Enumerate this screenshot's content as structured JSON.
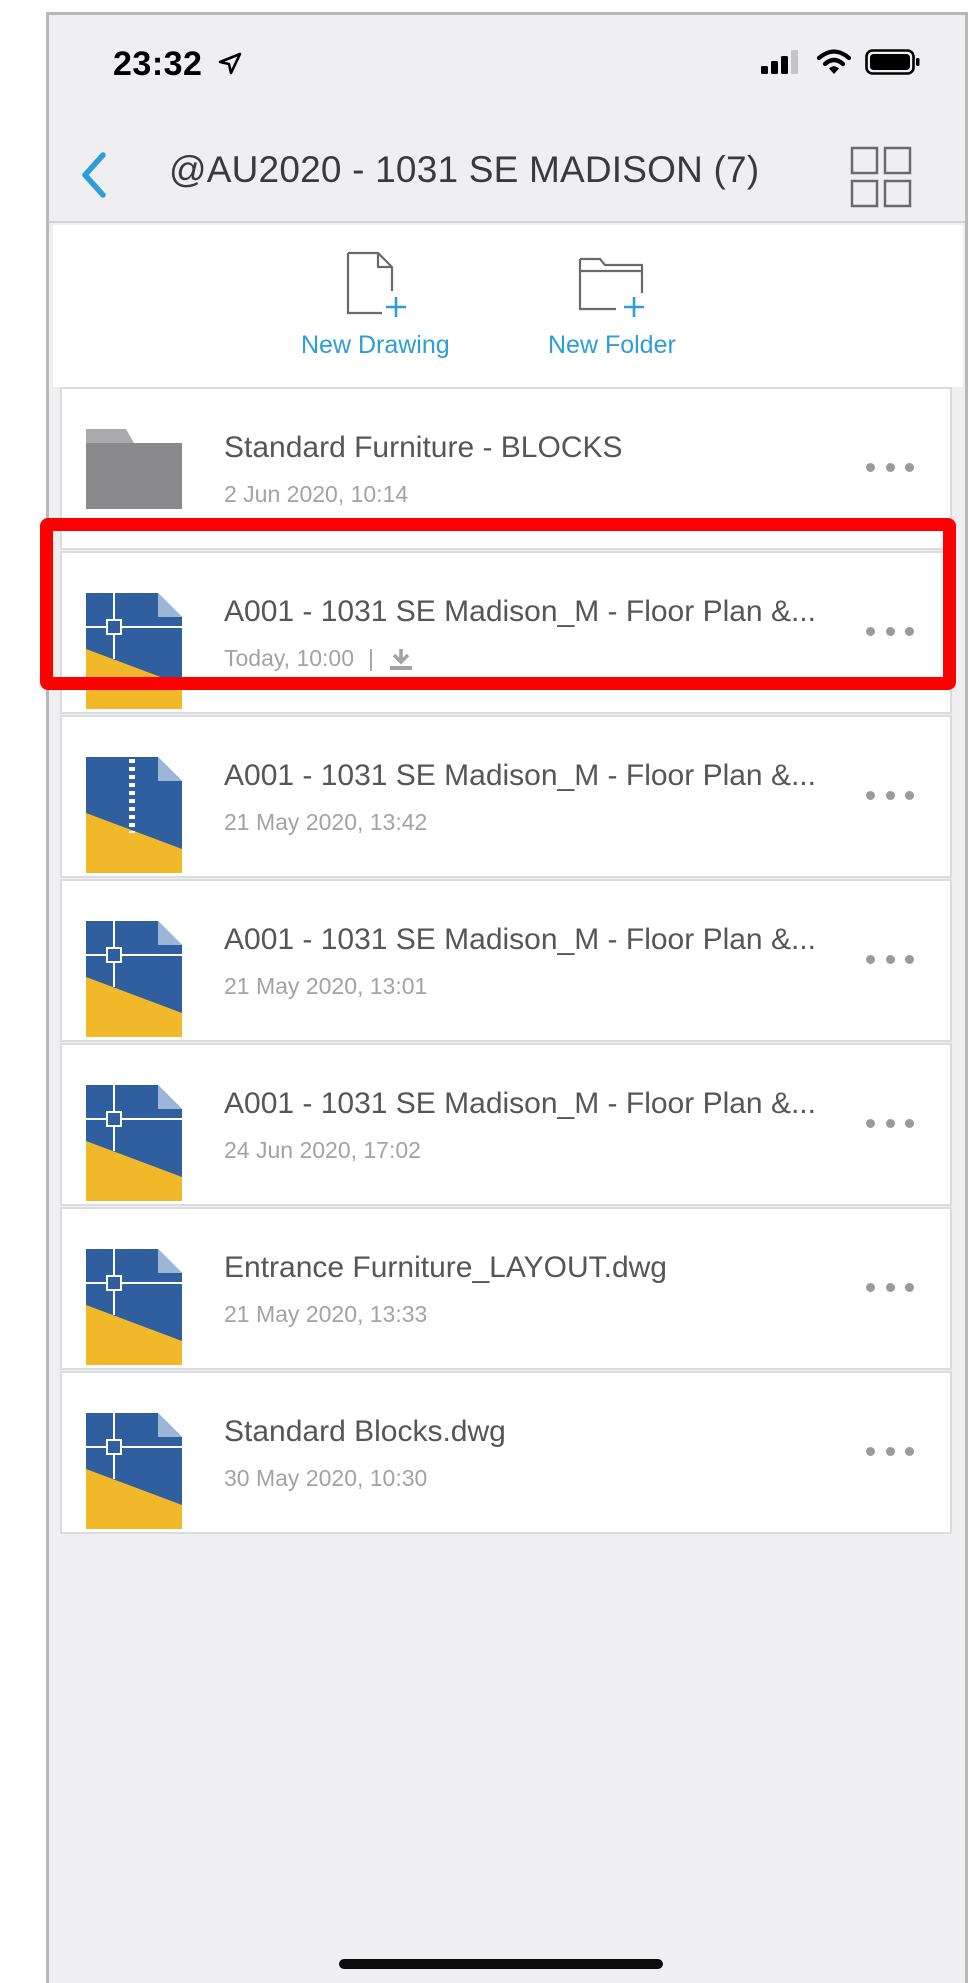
{
  "status_bar": {
    "time": "23:32",
    "icons": [
      "location-arrow-icon",
      "cellular-signal-icon",
      "wifi-icon",
      "battery-icon"
    ]
  },
  "nav": {
    "back_icon": "chevron-left-icon",
    "title": "@AU2020 - 1031 SE MADISON (7)",
    "view_toggle_icon": "grid-view-icon"
  },
  "actions": {
    "new_drawing": {
      "label": "New Drawing",
      "icon": "new-file-icon"
    },
    "new_folder": {
      "label": "New Folder",
      "icon": "new-folder-icon"
    }
  },
  "files": [
    {
      "type": "folder",
      "name": "Standard Furniture - BLOCKS",
      "date": "2 Jun 2020, 10:14",
      "downloaded": false
    },
    {
      "type": "drawing",
      "name": "A001 - 1031 SE Madison_M - Floor Plan &...",
      "date": "Today, 10:00",
      "separator": "|",
      "downloaded": true,
      "highlighted": true
    },
    {
      "type": "archive",
      "name": "A001 - 1031 SE Madison_M - Floor Plan &...",
      "date": "21 May 2020, 13:42",
      "downloaded": false
    },
    {
      "type": "drawing",
      "name": "A001 - 1031 SE Madison_M - Floor Plan &...",
      "date": "21 May 2020, 13:01",
      "downloaded": false
    },
    {
      "type": "drawing",
      "name": "A001 - 1031 SE Madison_M - Floor Plan &...",
      "date": "24 Jun 2020, 17:02",
      "downloaded": false
    },
    {
      "type": "drawing",
      "name": "Entrance Furniture_LAYOUT.dwg",
      "date": "21 May 2020, 13:33",
      "downloaded": false
    },
    {
      "type": "drawing",
      "name": "Standard Blocks.dwg",
      "date": "30 May 2020, 10:30",
      "downloaded": false
    }
  ],
  "colors": {
    "accent": "#2d9ed8",
    "highlight": "#ff0000",
    "dwg_blue": "#2f5f9f",
    "dwg_yellow": "#f1b82a",
    "folder_gray": "#8a8a8c"
  }
}
